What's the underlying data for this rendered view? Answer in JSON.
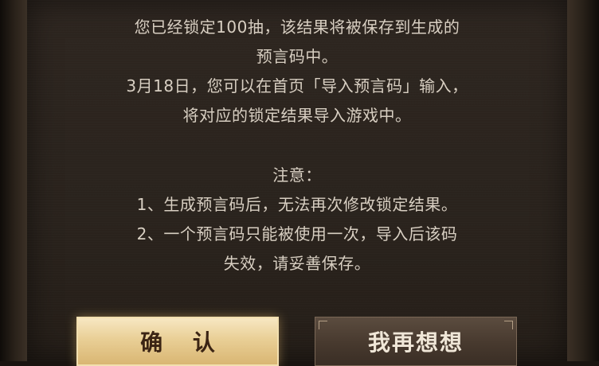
{
  "dialog": {
    "message_lines": [
      "您已经锁定100抽，该结果将被保存到生成的",
      "预言码中。",
      "3月18日，您可以在首页「导入预言码」输入，",
      "将对应的锁定结果导入游戏中。"
    ],
    "notes_title": "注意：",
    "notes": [
      "1、生成预言码后，无法再次修改锁定结果。",
      "2、一个预言码只能被使用一次，导入后该码",
      "失效，请妥善保存。"
    ]
  },
  "buttons": {
    "confirm_label": "确 认",
    "cancel_label": "我再想想"
  },
  "colors": {
    "text": "#d8cfc2",
    "confirm_bg": "#e9cf96",
    "confirm_text": "#3b2414",
    "cancel_bg": "#47392e",
    "cancel_text": "#f0e7d8"
  }
}
